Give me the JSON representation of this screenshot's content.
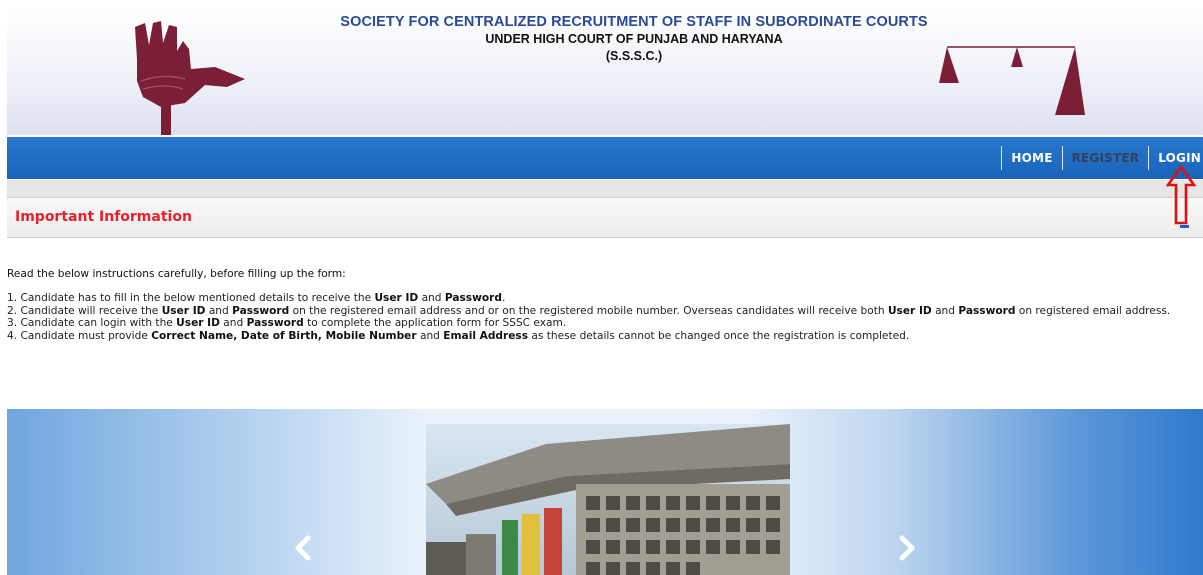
{
  "header": {
    "title": "SOCIETY FOR CENTRALIZED RECRUITMENT OF STAFF IN SUBORDINATE COURTS",
    "subtitle": "UNDER HIGH COURT OF PUNJAB AND HARYANA",
    "abbreviation": "(S.S.S.C.)",
    "logo_left": "open-hand-emblem",
    "logo_right": "scales-of-justice-emblem"
  },
  "nav": {
    "items": [
      {
        "label": "HOME"
      },
      {
        "label": "REGISTER"
      },
      {
        "label": "LOGIN"
      }
    ]
  },
  "info_panel": {
    "title": "Important Information",
    "collapse_icon": "minus-icon"
  },
  "instructions": {
    "intro": "Read the below instructions carefully, before filling up the form:",
    "items": [
      {
        "a": "1. Candidate has to fill in the below mentioned details to receive the ",
        "b1": "User ID",
        "c": " and ",
        "b2": "Password",
        "d": "."
      },
      {
        "a": "2. Candidate will receive the ",
        "b1": "User ID",
        "c": " and ",
        "b2": "Password",
        "d": " on the registered email address and or on the registered mobile number. Overseas candidates will receive both ",
        "b3": "User ID",
        "e": " and ",
        "b4": "Password",
        "f": " on registered email address."
      },
      {
        "a": "3. Candidate can login with the ",
        "b1": "User ID",
        "c": " and ",
        "b2": "Password",
        "d": " to complete the application form for SSSC exam."
      },
      {
        "a": "4. Candidate must provide ",
        "b1": "Correct Name, Date of Birth, Mobile Number",
        "c": " and ",
        "b2": "Email Address",
        "d": " as these details cannot be changed once the registration is completed."
      }
    ]
  },
  "carousel": {
    "prev_icon": "chevron-left-icon",
    "next_icon": "chevron-right-icon"
  },
  "colors": {
    "nav_blue": "#1a66bb",
    "title_blue": "#2b4a94",
    "info_red": "#e8202a",
    "emblem_maroon": "#7a1f35",
    "annotation_red": "#e01010"
  }
}
